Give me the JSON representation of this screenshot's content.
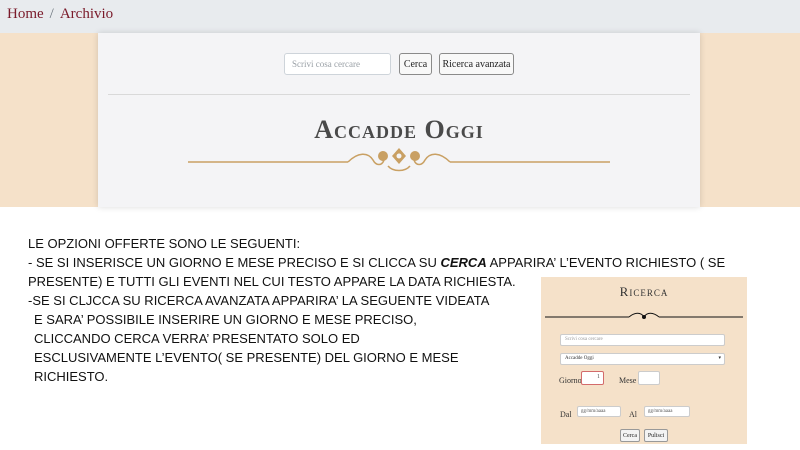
{
  "breadcrumb": {
    "home": "Home",
    "separator": "/",
    "current": "Archivio"
  },
  "header": {
    "search_placeholder": "Scrivi cosa cercare",
    "search_button": "Cerca",
    "advanced_button": "Ricerca avanzata",
    "title": "Accadde Oggi"
  },
  "instructions": {
    "line1": "LE OPZIONI OFFERTE SONO LE SEGUENTI:",
    "line2_pre": "- SE SI INSERISCE UN GIORNO E MESE PRECISO E SI CLICCA SU ",
    "line2_em": "CERCA",
    "line2_post": " APPARIRA’ L’EVENTO RICHIESTO ( SE",
    "line3": "PRESENTE) E TUTTI GLI EVENTI NEL CUI TESTO  APPARE LA DATA RICHIESTA.",
    "line4": "-SE SI CLJCCA SU RICERCA AVANZATA  APPARIRA’ LA SEGUENTE VIDEATA",
    "line5": "E SARA’ POSSIBILE INSERIRE UN GIORNO E MESE PRECISO,",
    "line6": "CLICCANDO CERCA  VERRA’ PRESENTATO SOLO ED",
    "line7": "ESCLUSIVAMENTE L’EVENTO( SE PRESENTE) DEL GIORNO E MESE",
    "line8": "RICHIESTO."
  },
  "inset": {
    "title": "Ricerca",
    "search_placeholder": "Scrivi cosa cercare",
    "select_value": "Accadde Oggi",
    "giorno_label": "Giorno",
    "giorno_value": "1",
    "mese_label": "Mese",
    "dal_label": "Dal",
    "dal_placeholder": "gg/mm/aaaa",
    "al_label": "Al",
    "al_placeholder": "gg/mm/aaaa",
    "cerca_button": "Cerca",
    "pulisci_button": "Pulisci"
  },
  "colors": {
    "beige": "#f5e1c9",
    "gold": "#c9a063",
    "breadcrumb_link": "#7a1a2a"
  },
  "icons": {
    "ornament": "floral-divider-icon"
  }
}
